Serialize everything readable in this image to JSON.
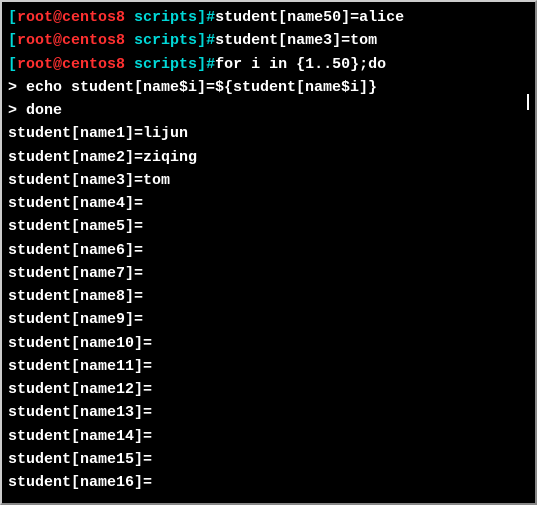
{
  "prompt": {
    "open_bracket": "[",
    "user_host": "root@centos8",
    "space": " ",
    "dir": "scripts",
    "close_bracket": "]",
    "hash": "#"
  },
  "commands": [
    "student[name50]=alice",
    "student[name3]=tom",
    "for i in {1..50};do"
  ],
  "continuations": [
    "> echo student[name$i]=${student[name$i]}",
    "> done"
  ],
  "output": [
    "student[name1]=lijun",
    "student[name2]=ziqing",
    "student[name3]=tom",
    "student[name4]=",
    "student[name5]=",
    "student[name6]=",
    "student[name7]=",
    "student[name8]=",
    "student[name9]=",
    "student[name10]=",
    "student[name11]=",
    "student[name12]=",
    "student[name13]=",
    "student[name14]=",
    "student[name15]=",
    "student[name16]="
  ]
}
